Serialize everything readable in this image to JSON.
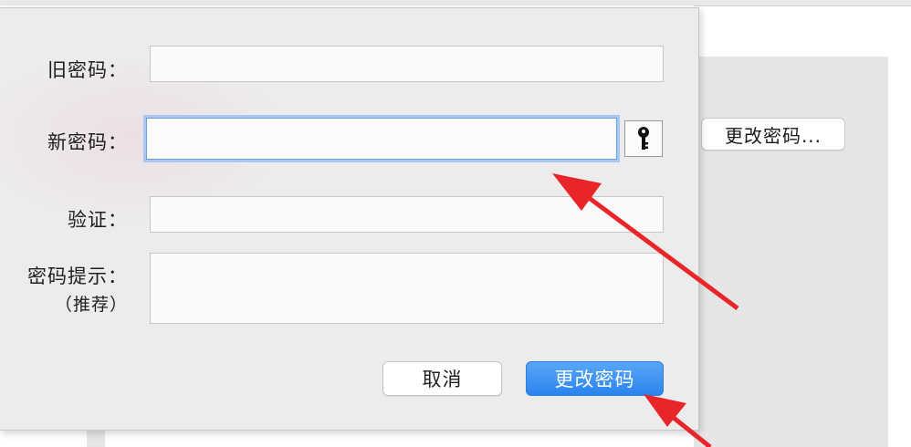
{
  "background": {
    "change_password_button_label": "更改密码..."
  },
  "dialog": {
    "old_password": {
      "label": "旧密码：",
      "value": ""
    },
    "new_password": {
      "label": "新密码：",
      "value": ""
    },
    "verify": {
      "label": "验证：",
      "value": ""
    },
    "hint": {
      "label": "密码提示：",
      "sublabel": "（推荐）",
      "value": ""
    },
    "key_icon": "key-icon",
    "cancel_label": "取消",
    "confirm_label": "更改密码"
  },
  "colors": {
    "accent": "#2a84ee",
    "focus_ring": "#a8c8f2",
    "annotation_arrow": "#e8262a"
  }
}
